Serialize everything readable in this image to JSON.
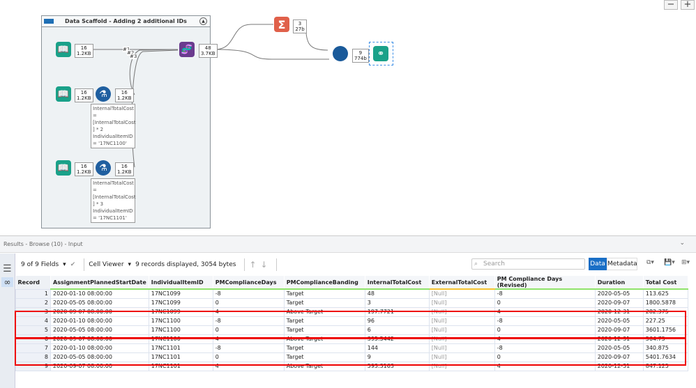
{
  "canvas": {
    "zoom_out": "−",
    "zoom_in": "+",
    "container_title": "Data Scaffold - Adding 2 additional IDs",
    "badges": {
      "input1": [
        "16",
        "1.2KB"
      ],
      "input2": [
        "16",
        "1.2KB"
      ],
      "formula1": [
        "16",
        "1.2KB"
      ],
      "input3": [
        "16",
        "1.2KB"
      ],
      "formula2": [
        "16",
        "1.2KB"
      ],
      "union": [
        "48",
        "3.7KB"
      ],
      "summarize": [
        "3",
        "27b"
      ],
      "join": [
        "9",
        "774b"
      ]
    },
    "union_labels": [
      "#1",
      "#2",
      "#3"
    ],
    "formula1_note": "InternalTotalCost\n=\n[InternalTotalCost\n] * 2\nIndividualItemID\n= '17NC1100'",
    "formula2_note": "InternalTotalCost\n=\n[InternalTotalCost\n] * 3\nIndividualItemID\n= '17NC1101'"
  },
  "results": {
    "title": "Results - Browse (10) - Input",
    "fields": "9 of 9 Fields",
    "cell_viewer": "Cell Viewer",
    "summary": "9 records displayed, 3054 bytes",
    "search_placeholder": "Search",
    "data_btn": "Data",
    "metadata_btn": "Metadata",
    "columns": [
      "Record",
      "AssignmentPlannedStartDate",
      "IndividualItemID",
      "PMComplianceDays",
      "PMComplianceBanding",
      "InternalTotalCost",
      "ExternalTotalCost",
      "PM Compliance Days (Revised)",
      "Duration",
      "Total Cost"
    ],
    "rows": [
      [
        "1",
        "2020-01-10 08:00:00",
        "17NC1099",
        "-8",
        "Target",
        "48",
        "[Null]",
        "-8",
        "2020-05-05",
        "113.625"
      ],
      [
        "2",
        "2020-05-05 08:00:00",
        "17NC1099",
        "0",
        "Target",
        "3",
        "[Null]",
        "0",
        "2020-09-07",
        "1800.5878"
      ],
      [
        "3",
        "2020-09-07 08:00:00",
        "17NC1099",
        "4",
        "Above Target",
        "197.7721",
        "[Null]",
        "4",
        "2020-12-31",
        "282.375"
      ],
      [
        "4",
        "2020-01-10 08:00:00",
        "17NC1100",
        "-8",
        "Target",
        "96",
        "[Null]",
        "-8",
        "2020-05-05",
        "227.25"
      ],
      [
        "5",
        "2020-05-05 08:00:00",
        "17NC1100",
        "0",
        "Target",
        "6",
        "[Null]",
        "0",
        "2020-09-07",
        "3601.1756"
      ],
      [
        "6",
        "2020-09-07 08:00:00",
        "17NC1100",
        "4",
        "Above Target",
        "395.5442",
        "[Null]",
        "4",
        "2020-12-31",
        "564.75"
      ],
      [
        "7",
        "2020-01-10 08:00:00",
        "17NC1101",
        "-8",
        "Target",
        "144",
        "[Null]",
        "-8",
        "2020-05-05",
        "340.875"
      ],
      [
        "8",
        "2020-05-05 08:00:00",
        "17NC1101",
        "0",
        "Target",
        "9",
        "[Null]",
        "0",
        "2020-09-07",
        "5401.7634"
      ],
      [
        "9",
        "2020-09-07 08:00:00",
        "17NC1101",
        "4",
        "Above Target",
        "593.3163",
        "[Null]",
        "4",
        "2020-12-31",
        "847.125"
      ]
    ]
  }
}
